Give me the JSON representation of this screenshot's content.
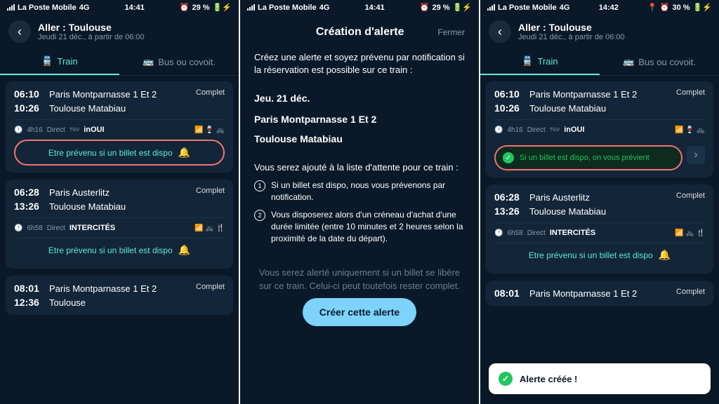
{
  "status": {
    "carrier": "La Poste Mobile",
    "net": "4G",
    "time1": "14:41",
    "time2": "14:41",
    "time3": "14:42",
    "bat1": "29 %",
    "bat2": "29 %",
    "bat3": "30 %"
  },
  "header": {
    "title": "Aller : Toulouse",
    "sub": "Jeudi 21 déc., à partir de 06:00"
  },
  "tabs": {
    "train": "Train",
    "bus": "Bus ou covoit."
  },
  "trips": [
    {
      "t1": "06:10",
      "s1": "Paris Montparnasse 1 Et 2",
      "t2": "10:26",
      "s2": "Toulouse Matabiau",
      "status": "Complet",
      "dur": "4h16",
      "type": "Direct",
      "brand": "inOUI",
      "brandpre": "TGV"
    },
    {
      "t1": "06:28",
      "s1": "Paris Austerlitz",
      "t2": "13:26",
      "s2": "Toulouse Matabiau",
      "status": "Complet",
      "dur": "6h58",
      "type": "Direct",
      "brand": "INTERCITÉS",
      "brandpre": ""
    },
    {
      "t1": "08:01",
      "s1": "Paris Montparnasse 1 Et 2",
      "t2": "12:36",
      "s2": "Toulouse",
      "status": "Complet",
      "dur": "",
      "type": "",
      "brand": "",
      "brandpre": ""
    }
  ],
  "alertBtn": "Etre prévenu si un billet est dispo",
  "alertSuccess": "Si un billet est dispo, on vous prévient",
  "modal": {
    "title": "Création d'alerte",
    "close": "Fermer",
    "intro": "Créez une alerte et soyez prévenu par notification si la réservation est possible sur ce train :",
    "date": "Jeu. 21 déc.",
    "from": "Paris Montparnasse 1 Et 2",
    "to": "Toulouse Matabiau",
    "waitlist": "Vous serez ajouté à la liste d'attente pour ce train :",
    "li1": "Si un billet est dispo, nous vous prévenons par notification.",
    "li2": "Vous disposerez alors d'un créneau d'achat d'une durée limitée (entre 10 minutes et 2 heures selon la proximité de la date du départ).",
    "foot": "Vous serez alerté uniquement si un billet se libère sur ce train. Celui-ci peut toutefois rester complet.",
    "cta": "Créer cette alerte"
  },
  "toast": "Alerte créée !"
}
